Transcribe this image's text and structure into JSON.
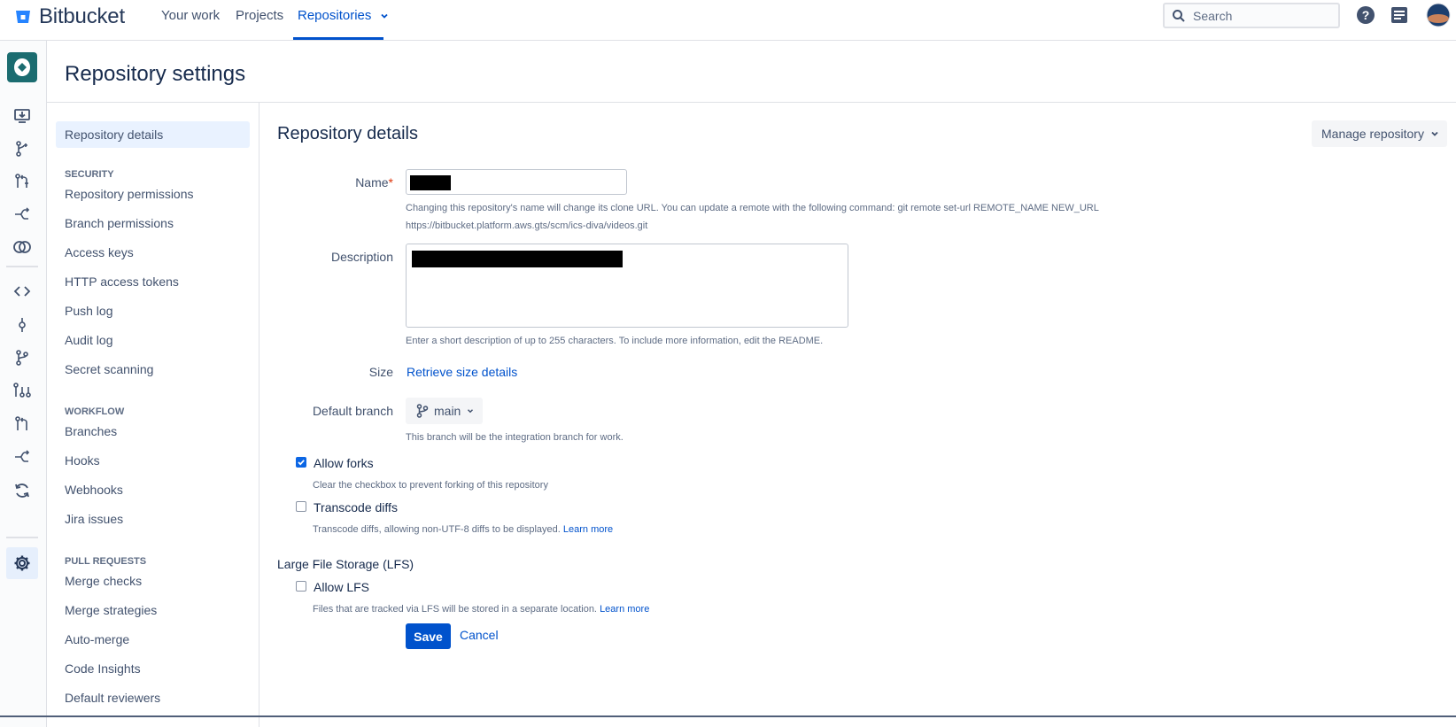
{
  "app": {
    "name": "Bitbucket"
  },
  "topnav": {
    "links": [
      {
        "label": "Your work"
      },
      {
        "label": "Projects"
      },
      {
        "label": "Repositories"
      }
    ],
    "search_placeholder": "Search"
  },
  "header": {
    "title": "Repository settings"
  },
  "settings_nav": {
    "active": "Repository details",
    "items": {
      "repository_details": "Repository details",
      "security_heading": "SECURITY",
      "repository_permissions": "Repository permissions",
      "branch_permissions": "Branch permissions",
      "access_keys": "Access keys",
      "http_access_tokens": "HTTP access tokens",
      "push_log": "Push log",
      "audit_log": "Audit log",
      "secret_scanning": "Secret scanning",
      "workflow_heading": "WORKFLOW",
      "branches": "Branches",
      "hooks": "Hooks",
      "webhooks": "Webhooks",
      "jira_issues": "Jira issues",
      "pull_requests_heading": "PULL REQUESTS",
      "merge_checks": "Merge checks",
      "merge_strategies": "Merge strategies",
      "auto_merge": "Auto-merge",
      "code_insights": "Code Insights",
      "default_reviewers": "Default reviewers"
    }
  },
  "main": {
    "title": "Repository details",
    "manage_label": "Manage repository",
    "name": {
      "label": "Name",
      "required_mark": "*",
      "help_line1": "Changing this repository's name will change its clone URL. You can update a remote with the following command: git remote set-url REMOTE_NAME NEW_URL",
      "help_line2": "https://bitbucket.platform.aws.gts/scm/ics-diva/videos.git"
    },
    "description": {
      "label": "Description",
      "help": "Enter a short description of up to 255 characters. To include more information, edit the README."
    },
    "size": {
      "label": "Size",
      "link": "Retrieve size details"
    },
    "default_branch": {
      "label": "Default branch",
      "value": "main",
      "help": "This branch will be the integration branch for work."
    },
    "allow_forks": {
      "label": "Allow forks",
      "checked": true,
      "help": "Clear the checkbox to prevent forking of this repository"
    },
    "transcode_diffs": {
      "label": "Transcode diffs",
      "checked": false,
      "help": "Transcode diffs, allowing non-UTF-8 diffs to be displayed.",
      "learn_more": "Learn more"
    },
    "lfs": {
      "title": "Large File Storage (LFS)",
      "label": "Allow LFS",
      "checked": false,
      "help": "Files that are tracked via LFS will be stored in a separate location.",
      "learn_more": "Learn more"
    },
    "save_label": "Save",
    "cancel_label": "Cancel"
  },
  "colors": {
    "accent": "#0052cc",
    "checkbox_on": "#0c66e4",
    "repo_avatar": "#1b6c70"
  }
}
